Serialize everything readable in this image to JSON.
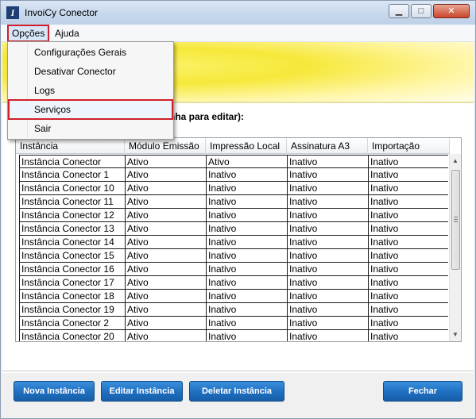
{
  "window": {
    "title": "InvoiCy Conector",
    "icon_letter": "I"
  },
  "controls": {
    "minimize": "▁",
    "maximize": "□",
    "close": "✕"
  },
  "menubar": {
    "items": [
      "Opções",
      "Ajuda"
    ]
  },
  "dropdown": {
    "items": [
      "Configurações Gerais",
      "Desativar Conector",
      "Logs",
      "Serviços",
      "Sair"
    ]
  },
  "section": {
    "label": "nha para editar):"
  },
  "table": {
    "columns": [
      "Instância",
      "Módulo Emissão",
      "Impressão Local",
      "Assinatura A3",
      "Importação"
    ],
    "rows": [
      [
        "Instância Conector",
        "Ativo",
        "Ativo",
        "Inativo",
        "Inativo"
      ],
      [
        "Instância Conector 1",
        "Ativo",
        "Inativo",
        "Inativo",
        "Inativo"
      ],
      [
        "Instância Conector 10",
        "Ativo",
        "Inativo",
        "Inativo",
        "Inativo"
      ],
      [
        "Instância Conector 11",
        "Ativo",
        "Inativo",
        "Inativo",
        "Inativo"
      ],
      [
        "Instância Conector 12",
        "Ativo",
        "Inativo",
        "Inativo",
        "Inativo"
      ],
      [
        "Instância Conector 13",
        "Ativo",
        "Inativo",
        "Inativo",
        "Inativo"
      ],
      [
        "Instância Conector 14",
        "Ativo",
        "Inativo",
        "Inativo",
        "Inativo"
      ],
      [
        "Instância Conector 15",
        "Ativo",
        "Inativo",
        "Inativo",
        "Inativo"
      ],
      [
        "Instância Conector 16",
        "Ativo",
        "Inativo",
        "Inativo",
        "Inativo"
      ],
      [
        "Instância Conector 17",
        "Ativo",
        "Inativo",
        "Inativo",
        "Inativo"
      ],
      [
        "Instância Conector 18",
        "Ativo",
        "Inativo",
        "Inativo",
        "Inativo"
      ],
      [
        "Instância Conector 19",
        "Ativo",
        "Inativo",
        "Inativo",
        "Inativo"
      ],
      [
        "Instância Conector 2",
        "Ativo",
        "Inativo",
        "Inativo",
        "Inativo"
      ],
      [
        "Instância Conector 20",
        "Ativo",
        "Inativo",
        "Inativo",
        "Inativo"
      ]
    ]
  },
  "buttons": {
    "new": "Nova Instância",
    "edit": "Editar Instância",
    "delete": "Deletar Instância",
    "close": "Fechar"
  },
  "colors": {
    "accent_blue": "#1f6fbf",
    "highlight_red": "#d0202a",
    "banner_yellow": "#f6e83a"
  },
  "icons": {
    "app": "app-logo-icon",
    "scroll_up": "scroll-up-arrow-icon",
    "scroll_down": "scroll-down-arrow-icon"
  }
}
